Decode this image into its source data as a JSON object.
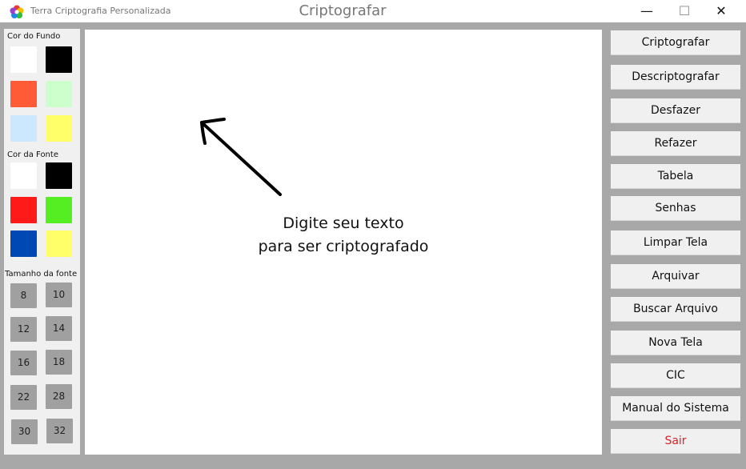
{
  "window": {
    "app_name": "Terra Criptografia Personalizada",
    "title": "Criptografar",
    "minimize_glyph": "—",
    "maximize_glyph": "☐",
    "close_glyph": "✕"
  },
  "left_panel": {
    "background_label": "Cor do Fundo",
    "background_colors": [
      "#ffffff",
      "#000000",
      "#ff5b36",
      "#ccffcc",
      "#cce8ff",
      "#ffff6a"
    ],
    "font_label": "Cor da Fonte",
    "font_colors": [
      "#ffffff",
      "#000000",
      "#ff1a1a",
      "#55ee22",
      "#0048b4",
      "#ffff6a"
    ],
    "size_label": "Tamanho da fonte",
    "font_sizes": [
      "8",
      "10",
      "12",
      "14",
      "16",
      "18",
      "22",
      "28",
      "30",
      "32"
    ]
  },
  "editor": {
    "hint_line1": "Digite seu texto",
    "hint_line2": "para ser criptografado",
    "arrow_icon": "arrow-up-left-icon"
  },
  "actions": [
    {
      "label": "Criptografar"
    },
    {
      "label": "Descriptografar"
    },
    {
      "label": "Desfazer"
    },
    {
      "label": "Refazer"
    },
    {
      "label": "Tabela"
    },
    {
      "label": "Senhas"
    },
    {
      "label": "Limpar Tela"
    },
    {
      "label": "Arquivar"
    },
    {
      "label": "Buscar Arquivo"
    },
    {
      "label": "Nova Tela"
    },
    {
      "label": "CIC"
    },
    {
      "label": "Manual do Sistema"
    },
    {
      "label": "Sair",
      "color": "#e0202a"
    }
  ]
}
